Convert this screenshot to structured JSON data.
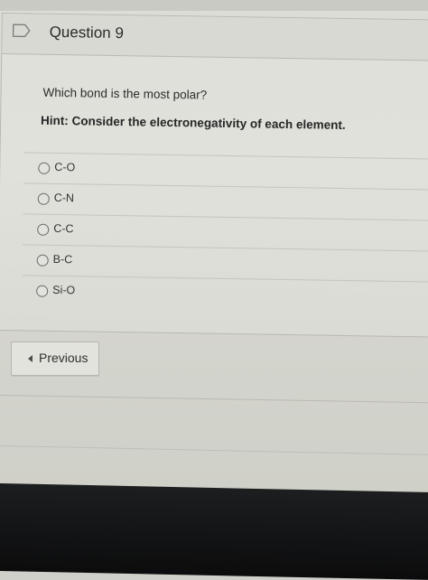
{
  "question": {
    "title": "Question 9",
    "text": "Which bond is the most polar?",
    "hint": "Hint: Consider the electronegativity of each element."
  },
  "answers": [
    {
      "label": "C-O",
      "selected": false
    },
    {
      "label": "C-N",
      "selected": false
    },
    {
      "label": "C-C",
      "selected": false
    },
    {
      "label": "B-C",
      "selected": false
    },
    {
      "label": "Si-O",
      "selected": false
    }
  ],
  "navigation": {
    "previous_label": "Previous"
  },
  "icons": {
    "flag": "flag-icon",
    "previous": "caret-left-icon",
    "radio": "radio-button"
  },
  "colors": {
    "background": "#dcddd7",
    "text": "#2b2d2c",
    "border": "#b8b9b2",
    "bezel": "#121314"
  }
}
